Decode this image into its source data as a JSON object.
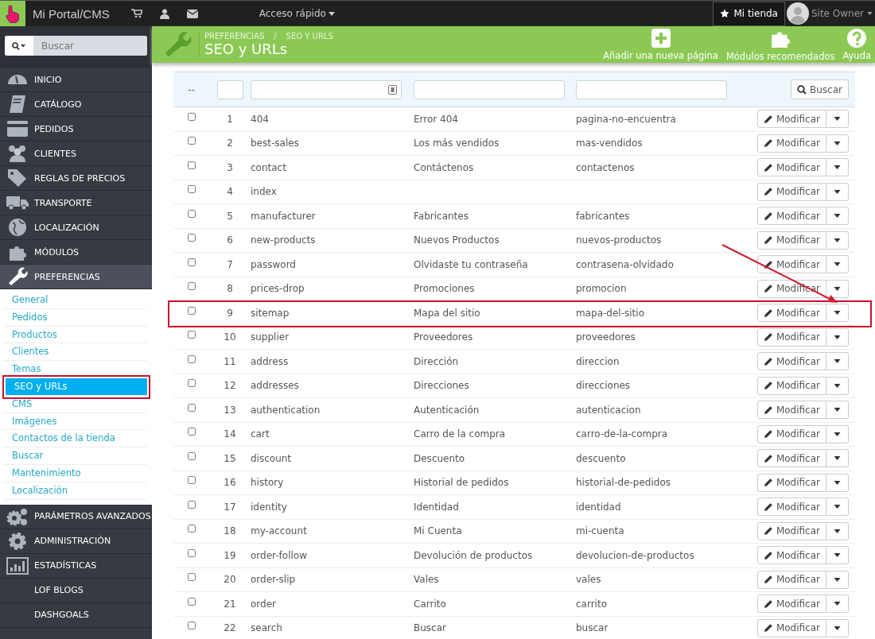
{
  "topbar": {
    "brand": "Mi Portal/CMS",
    "quick_access": "Acceso rápido",
    "shop_button": "Mi tienda",
    "user": "Site Owner"
  },
  "sidebar": {
    "search": {
      "placeholder": "Buscar"
    },
    "menu": [
      {
        "label": "INICIO",
        "selected": false
      },
      {
        "label": "CATÁLOGO",
        "selected": false
      },
      {
        "label": "PEDIDOS",
        "selected": false
      },
      {
        "label": "CLIENTES",
        "selected": false
      },
      {
        "label": "REGLAS DE PRECIOS",
        "selected": false
      },
      {
        "label": "TRANSPORTE",
        "selected": false
      },
      {
        "label": "LOCALIZACIÓN",
        "selected": false
      },
      {
        "label": "MÓDULOS",
        "selected": false
      },
      {
        "label": "PREFERENCIAS",
        "selected": true,
        "expanded": true,
        "children": [
          {
            "label": "General",
            "selected": false,
            "highlighted": false
          },
          {
            "label": "Pedidos",
            "selected": false,
            "highlighted": false
          },
          {
            "label": "Productos",
            "selected": false,
            "highlighted": false
          },
          {
            "label": "Clientes",
            "selected": false,
            "highlighted": false
          },
          {
            "label": "Temas",
            "selected": false,
            "highlighted": false
          },
          {
            "label": "SEO y URLs",
            "selected": true,
            "highlighted": true
          },
          {
            "label": "CMS",
            "selected": false,
            "highlighted": false
          },
          {
            "label": "Imágenes",
            "selected": false,
            "highlighted": false
          },
          {
            "label": "Contactos de la tienda",
            "selected": false,
            "highlighted": false
          },
          {
            "label": "Buscar",
            "selected": false,
            "highlighted": false
          },
          {
            "label": "Mantenimiento",
            "selected": false,
            "highlighted": false
          },
          {
            "label": "Localización",
            "selected": false,
            "highlighted": false
          }
        ]
      },
      {
        "label": "PARÁMETROS AVANZADOS",
        "selected": false
      },
      {
        "label": "ADMINISTRACIÓN",
        "selected": false
      },
      {
        "label": "ESTADÍSTICAS",
        "selected": false
      },
      {
        "label": "LOF BLOGS",
        "selected": false
      },
      {
        "label": "DASHGOALS",
        "selected": false
      }
    ]
  },
  "header": {
    "breadcrumb": [
      "PREFERENCIAS",
      "SEO Y URLS"
    ],
    "breadcrumb_separator": "/",
    "title": "SEO y URLs",
    "actions": [
      "Añadir una nueva página",
      "Módulos recomendados",
      "Ayuda"
    ]
  },
  "table": {
    "filter_row": {
      "bulk": "--",
      "search_button": "Buscar"
    },
    "rows": [
      {
        "id": "1",
        "page": "404",
        "title": "Error 404",
        "url": "pagina-no-encuentra",
        "action": "Modificar",
        "checked": false,
        "highlighted": false
      },
      {
        "id": "2",
        "page": "best-sales",
        "title": "Los más vendidos",
        "url": "mas-vendidos",
        "action": "Modificar",
        "checked": false,
        "highlighted": false
      },
      {
        "id": "3",
        "page": "contact",
        "title": "Contáctenos",
        "url": "contactenos",
        "action": "Modificar",
        "checked": false,
        "highlighted": false
      },
      {
        "id": "4",
        "page": "index",
        "action": "Modificar",
        "checked": false,
        "highlighted": false
      },
      {
        "id": "5",
        "page": "manufacturer",
        "title": "Fabricantes",
        "url": "fabricantes",
        "action": "Modificar",
        "checked": false,
        "highlighted": false
      },
      {
        "id": "6",
        "page": "new-products",
        "title": "Nuevos Productos",
        "url": "nuevos-productos",
        "action": "Modificar",
        "checked": false,
        "highlighted": false
      },
      {
        "id": "7",
        "page": "password",
        "title": "Olvidaste tu contraseña",
        "url": "contrasena-olvidado",
        "action": "Modificar",
        "checked": false,
        "highlighted": false
      },
      {
        "id": "8",
        "page": "prices-drop",
        "title": "Promociones",
        "url": "promocion",
        "action": "Modificar",
        "checked": false,
        "highlighted": false
      },
      {
        "id": "9",
        "page": "sitemap",
        "title": "Mapa del sitio",
        "url": "mapa-del-sitio",
        "action": "Modificar",
        "checked": false,
        "highlighted": true
      },
      {
        "id": "10",
        "page": "supplier",
        "title": "Proveedores",
        "url": "proveedores",
        "action": "Modificar",
        "checked": false,
        "highlighted": false
      },
      {
        "id": "11",
        "page": "address",
        "title": "Dirección",
        "url": "direccion",
        "action": "Modificar",
        "checked": false,
        "highlighted": false
      },
      {
        "id": "12",
        "page": "addresses",
        "title": "Direcciones",
        "url": "direcciones",
        "action": "Modificar",
        "checked": false,
        "highlighted": false
      },
      {
        "id": "13",
        "page": "authentication",
        "title": "Autenticación",
        "url": "autenticacion",
        "action": "Modificar",
        "checked": false,
        "highlighted": false
      },
      {
        "id": "14",
        "page": "cart",
        "title": "Carro de la compra",
        "url": "carro-de-la-compra",
        "action": "Modificar",
        "checked": false,
        "highlighted": false
      },
      {
        "id": "15",
        "page": "discount",
        "title": "Descuento",
        "url": "descuento",
        "action": "Modificar",
        "checked": false,
        "highlighted": false
      },
      {
        "id": "16",
        "page": "history",
        "title": "Historial de pedidos",
        "url": "historial-de-pedidos",
        "action": "Modificar",
        "checked": false,
        "highlighted": false
      },
      {
        "id": "17",
        "page": "identity",
        "title": "Identidad",
        "url": "identidad",
        "action": "Modificar",
        "checked": false,
        "highlighted": false
      },
      {
        "id": "18",
        "page": "my-account",
        "title": "Mi Cuenta",
        "url": "mi-cuenta",
        "action": "Modificar",
        "checked": false,
        "highlighted": false
      },
      {
        "id": "19",
        "page": "order-follow",
        "title": "Devolución de productos",
        "url": "devolucion-de-productos",
        "action": "Modificar",
        "checked": false,
        "highlighted": false
      },
      {
        "id": "20",
        "page": "order-slip",
        "title": "Vales",
        "url": "vales",
        "action": "Modificar",
        "checked": false,
        "highlighted": false
      },
      {
        "id": "21",
        "page": "order",
        "title": "Carrito",
        "url": "carrito",
        "action": "Modificar",
        "checked": false,
        "highlighted": false
      },
      {
        "id": "22",
        "page": "search",
        "title": "Buscar",
        "url": "buscar",
        "action": "Modificar",
        "checked": false,
        "highlighted": false
      }
    ]
  },
  "annotation": {
    "arrow": true
  }
}
